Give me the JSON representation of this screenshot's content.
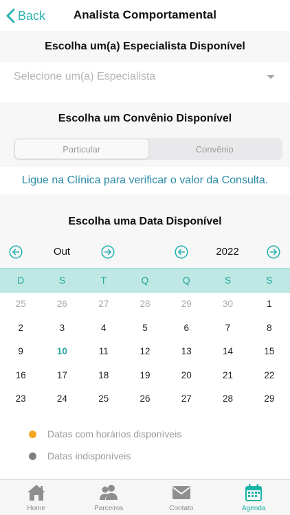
{
  "nav": {
    "back_label": "Back",
    "title": "Analista Comportamental"
  },
  "specialist": {
    "title": "Escolha um(a) Especialista Disponível",
    "placeholder": "Selecione um(a) Especialista"
  },
  "convenio": {
    "title": "Escolha um Convênio Disponível",
    "options": [
      "Particular",
      "Convênio"
    ],
    "selected": "Particular"
  },
  "info_text": "Ligue na Clínica para verificar o valor da Consulta.",
  "date": {
    "title": "Escolha uma Data Disponível",
    "month": "Out",
    "year": "2022",
    "weekdays": [
      "D",
      "S",
      "T",
      "Q",
      "Q",
      "S",
      "S"
    ],
    "weeks": [
      [
        "25",
        "26",
        "27",
        "28",
        "29",
        "30",
        "1"
      ],
      [
        "2",
        "3",
        "4",
        "5",
        "6",
        "7",
        "8"
      ],
      [
        "9",
        "10",
        "11",
        "12",
        "13",
        "14",
        "15"
      ],
      [
        "16",
        "17",
        "18",
        "19",
        "20",
        "21",
        "22"
      ],
      [
        "23",
        "24",
        "25",
        "26",
        "27",
        "28",
        "29"
      ]
    ],
    "today": "10"
  },
  "legend": [
    {
      "label": "Datas com horários disponíveis",
      "color": "#f5a623"
    },
    {
      "label": "Datas indisponíveis",
      "color": "#7f7f7f"
    }
  ],
  "tabs": [
    {
      "label": "Home",
      "icon": "home-icon"
    },
    {
      "label": "Parceiros",
      "icon": "people-icon"
    },
    {
      "label": "Contato",
      "icon": "mail-icon"
    },
    {
      "label": "Agenda",
      "icon": "calendar-icon"
    }
  ],
  "colors": {
    "accent": "#2ab3b1",
    "link": "#2b8aa6",
    "header_band": "#bfe8e4",
    "tab_active": "#18b3a7"
  }
}
